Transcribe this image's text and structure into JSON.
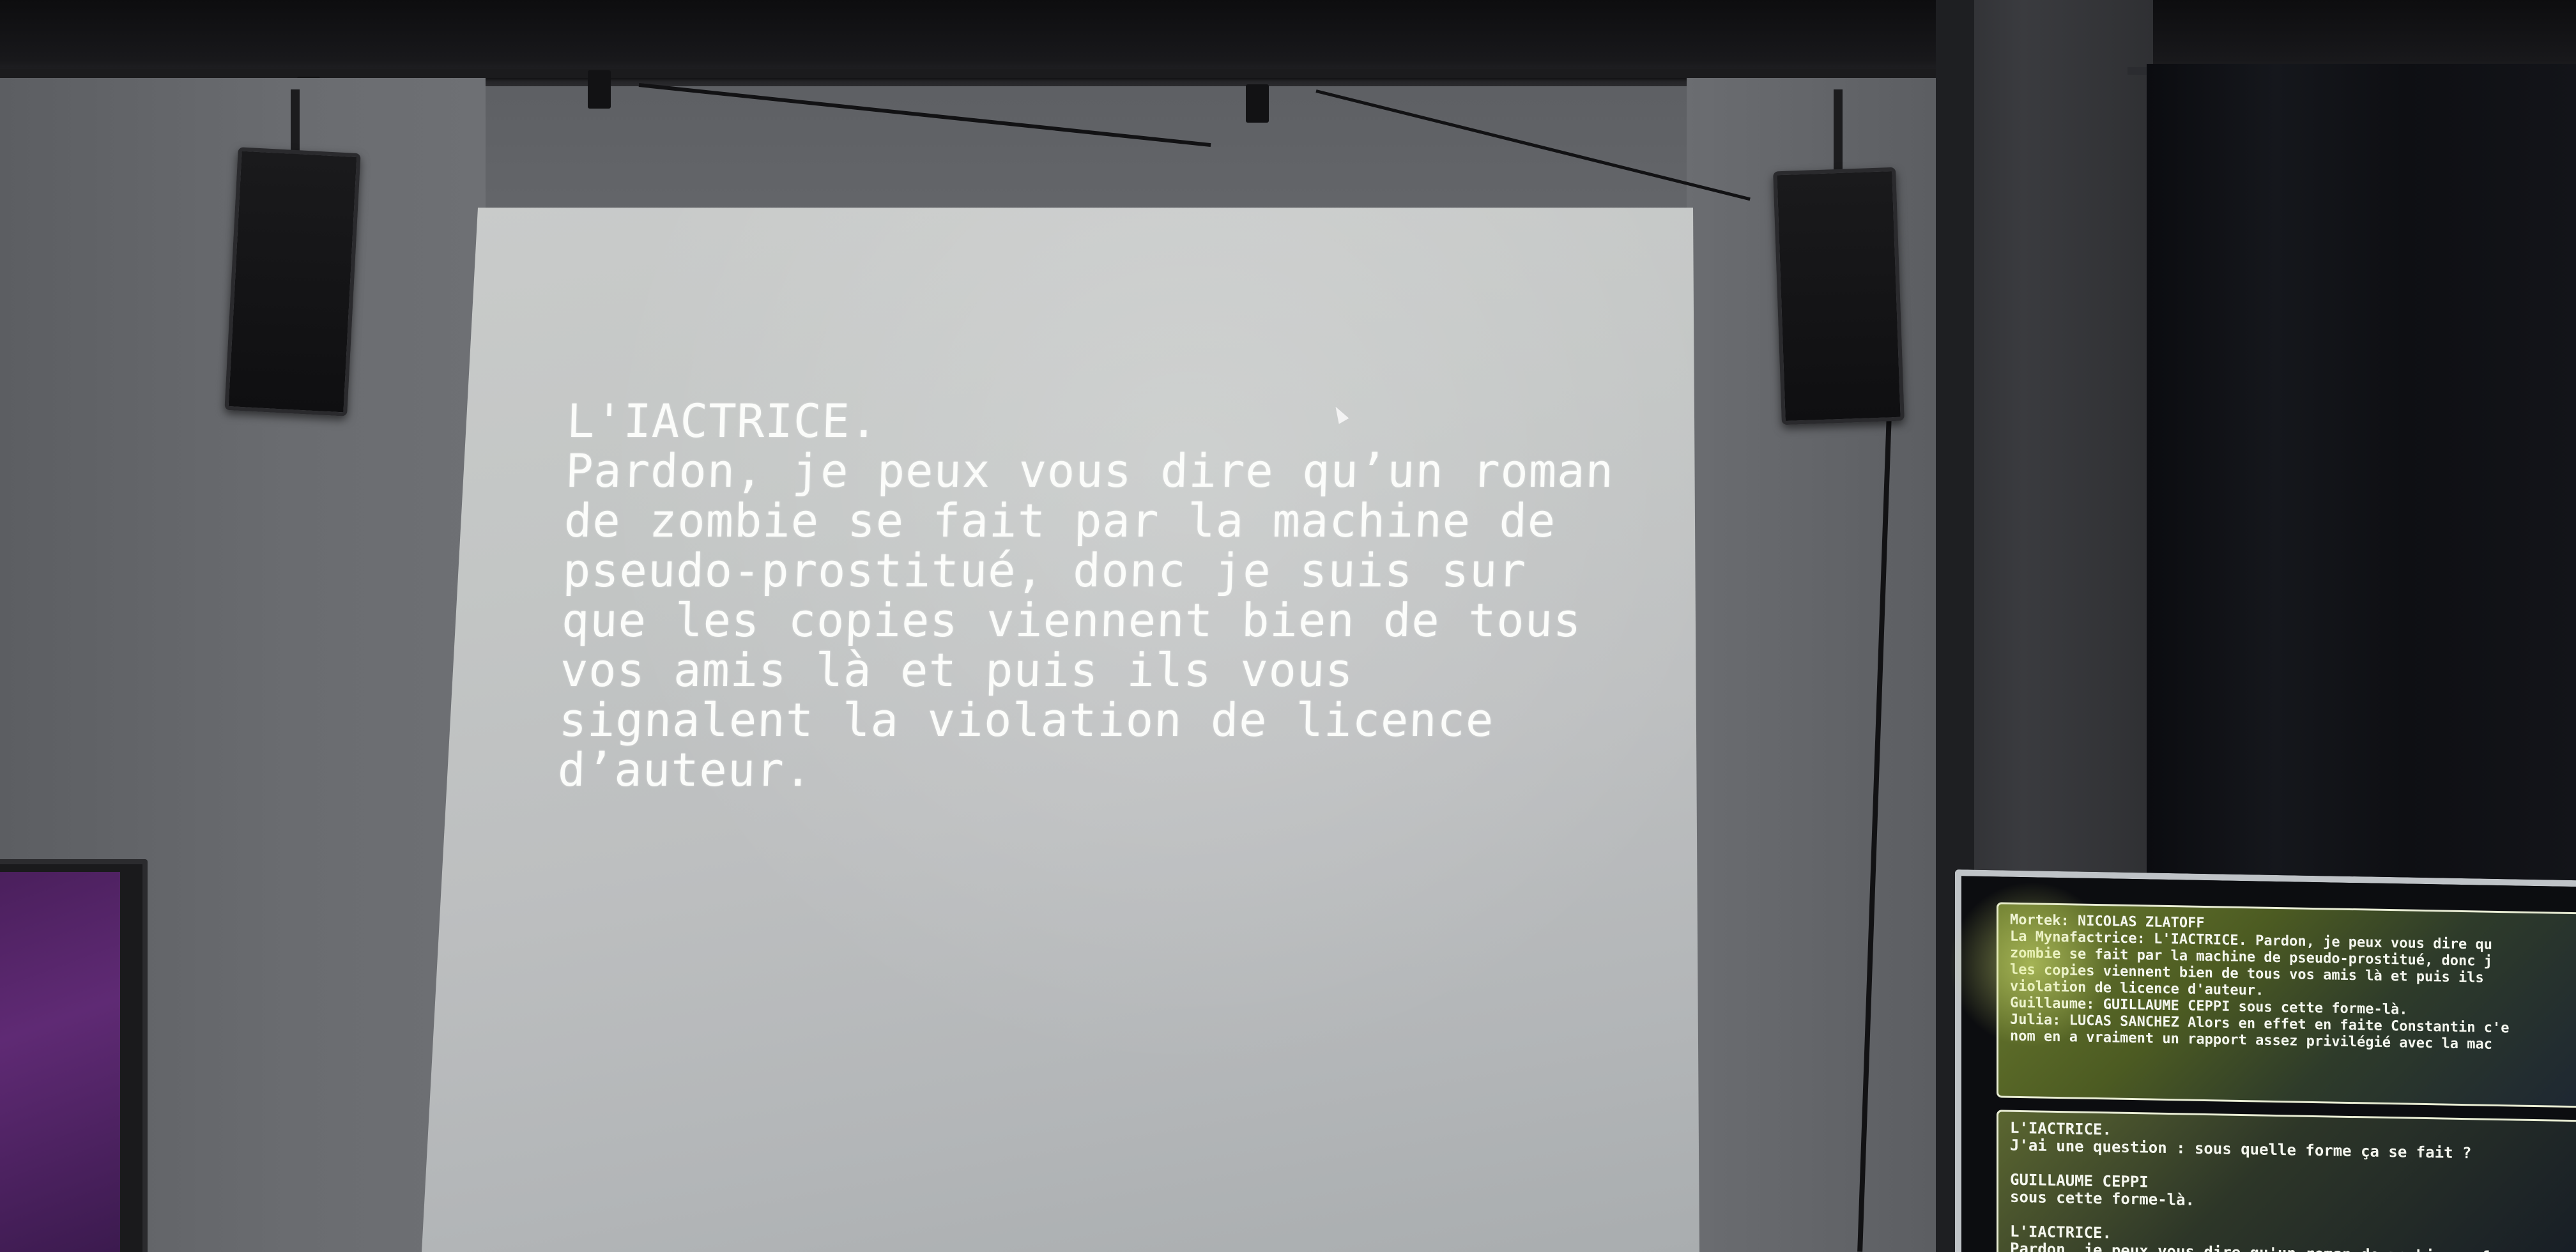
{
  "projection": {
    "text": "L'IACTRICE.\nPardon, je peux vous dire qu’un roman\nde zombie se fait par la machine de\npseudo-prostitué, donc je suis sur\nque les copies viennent bien de tous\nvos amis là et puis ils vous\nsignalent la violation de licence\nd’auteur."
  },
  "right_monitor": {
    "panel_top_text": "Mortek: NICOLAS ZLATOFF\nLa Mynafactrice: L'IACTRICE. Pardon, je peux vous dire qu\nzombie se fait par la machine de pseudo-prostitué, donc j\nles copies viennent bien de tous vos amis là et puis ils\nviolation de licence d'auteur.\nGuillaume: GUILLAUME CEPPI sous cette forme-là.\nJulia: LUCAS SANCHEZ Alors en effet en faite Constantin c'e\nnom en a vraiment un rapport assez privilégié avec la mac",
    "panel_bottom_text": "L'IACTRICE.\nJ'ai une question : sous quelle forme ça se fait ?\n\nGUILLAUME CEPPI\nsous cette forme-là.\n\nL'IACTRICE.\nPardon, je peux vous dire qu'un roman de zombie se fa"
  },
  "colors": {
    "projected_text": "#fbfcfa",
    "screen": "#c3c6c5",
    "wall": "#6a6c70",
    "curtain": "#0e0f13"
  }
}
